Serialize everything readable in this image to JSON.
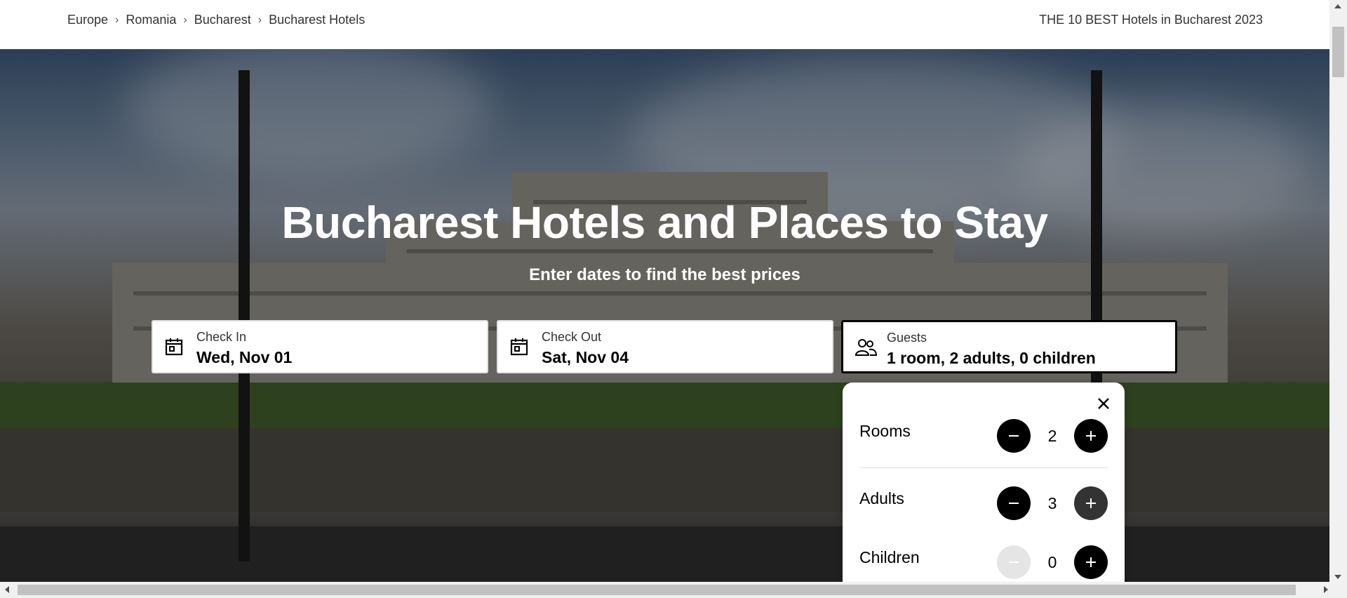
{
  "breadcrumb": {
    "items": [
      {
        "label": "Europe"
      },
      {
        "label": "Romania"
      },
      {
        "label": "Bucharest"
      },
      {
        "label": "Bucharest Hotels"
      }
    ],
    "separator": "›"
  },
  "page_heading_link": "THE 10 BEST Hotels in Bucharest 2023",
  "hero": {
    "title": "Bucharest Hotels and Places to Stay",
    "subtitle": "Enter dates to find the best prices",
    "background_image": "Palace of the Parliament, Bucharest"
  },
  "search": {
    "check_in": {
      "label": "Check In",
      "value": "Wed, Nov 01",
      "icon": "calendar-icon"
    },
    "check_out": {
      "label": "Check Out",
      "value": "Sat, Nov 04",
      "icon": "calendar-icon"
    },
    "guests": {
      "label": "Guests",
      "value": "1 room, 2 adults, 0 children",
      "icon": "people-icon"
    }
  },
  "guests_popup": {
    "close_icon": "close-icon",
    "rows": [
      {
        "label": "Rooms",
        "value": "2",
        "minus_enabled": true,
        "plus_enabled": true
      },
      {
        "label": "Adults",
        "value": "3",
        "minus_enabled": true,
        "plus_enabled": true
      },
      {
        "label": "Children",
        "value": "0",
        "minus_enabled": false,
        "plus_enabled": true
      }
    ]
  },
  "colors": {
    "text_primary": "#000000",
    "text_secondary": "#333333",
    "stepper_button": "#000000",
    "stepper_disabled": "#e5e5e5"
  }
}
